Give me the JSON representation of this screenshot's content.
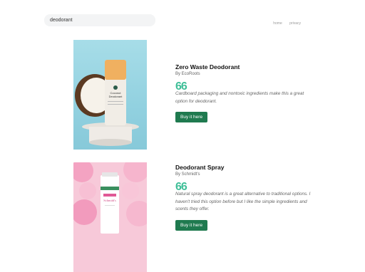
{
  "search": {
    "value": "deodorant"
  },
  "nav": {
    "links": [
      "home",
      "privacy"
    ]
  },
  "products": [
    {
      "title": "Zero Waste Deodorant",
      "brand": "By EcoRoots",
      "quote_mark": "66",
      "description": "Cardboard packaging and nontoxic ingredients make this a great option for deodorant.",
      "button": "Buy it here",
      "image_label": [
        "Coconut",
        "Deodorant"
      ]
    },
    {
      "title": "Deodorant Spray",
      "brand": "By Schmidt's",
      "quote_mark": "66",
      "description": "Natural spray deodorant is a great alternative to traditional options. I haven't tried this option before but I like the simple ingredients and scents they offer.",
      "button": "Buy it here",
      "image_label": [
        "Schmidt's"
      ]
    }
  ],
  "colors": {
    "accent": "#3fbf98",
    "button": "#1f7a4f"
  }
}
